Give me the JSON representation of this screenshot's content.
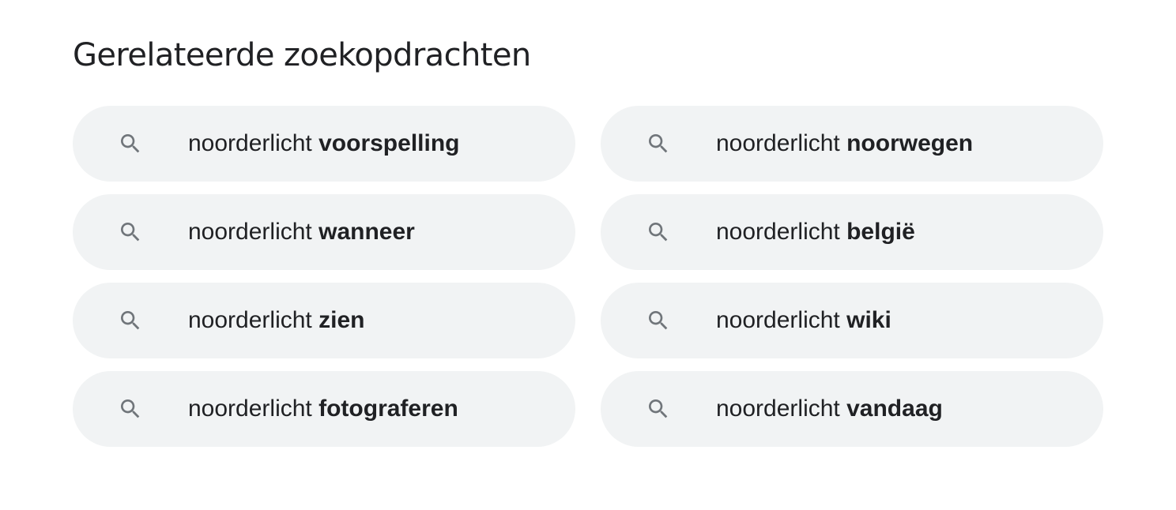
{
  "heading": "Gerelateerde zoekopdrachten",
  "colors": {
    "chip_background": "#f1f3f4",
    "text": "#202124",
    "icon": "#70757a"
  },
  "related_searches": [
    {
      "base": "noorderlicht",
      "suffix": "voorspelling",
      "icon": "search-icon"
    },
    {
      "base": "noorderlicht",
      "suffix": "noorwegen",
      "icon": "search-icon"
    },
    {
      "base": "noorderlicht",
      "suffix": "wanneer",
      "icon": "search-icon"
    },
    {
      "base": "noorderlicht",
      "suffix": "belgië",
      "icon": "search-icon"
    },
    {
      "base": "noorderlicht",
      "suffix": "zien",
      "icon": "search-icon"
    },
    {
      "base": "noorderlicht",
      "suffix": "wiki",
      "icon": "search-icon"
    },
    {
      "base": "noorderlicht",
      "suffix": "fotograferen",
      "icon": "search-icon"
    },
    {
      "base": "noorderlicht",
      "suffix": "vandaag",
      "icon": "search-icon"
    }
  ]
}
